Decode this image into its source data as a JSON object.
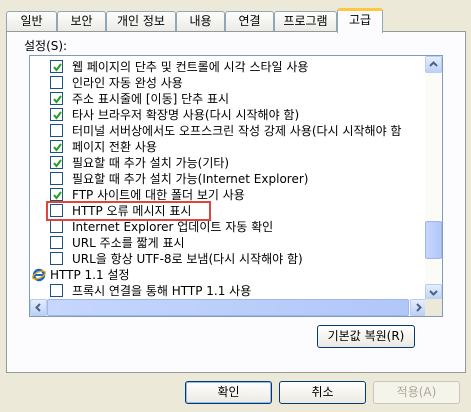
{
  "tabs": [
    {
      "label": "일반"
    },
    {
      "label": "보안"
    },
    {
      "label": "개인 정보"
    },
    {
      "label": "내용"
    },
    {
      "label": "연결"
    },
    {
      "label": "프로그램"
    },
    {
      "label": "고급",
      "active": true
    }
  ],
  "settings": {
    "label": "설정(S):",
    "items": [
      {
        "label": "웹 페이지의 단추 및 컨트롤에 시각 스타일 사용",
        "checked": true
      },
      {
        "label": "인라인 자동 완성 사용",
        "checked": false
      },
      {
        "label": "주소 표시줄에 [이동] 단추 표시",
        "checked": true
      },
      {
        "label": "타사 브라우저 확장명 사용(다시 시작해야 함)",
        "checked": true
      },
      {
        "label": "터미널 서버상에서도 오프스크린 작성 강제 사용(다시 시작해야 함",
        "checked": false
      },
      {
        "label": "페이지 전환 사용",
        "checked": true
      },
      {
        "label": "필요할 때 추가 설치 가능(기타)",
        "checked": true
      },
      {
        "label": "필요할 때 추가 설치 가능(Internet Explorer)",
        "checked": false
      },
      {
        "label": "FTP 사이트에 대한 폴더 보기 사용",
        "checked": true
      },
      {
        "label": "HTTP 오류 메시지 표시",
        "checked": false,
        "highlighted": true
      },
      {
        "label": "Internet Explorer 업데이트 자동 확인",
        "checked": false
      },
      {
        "label": "URL 주소를 짧게 표시",
        "checked": false
      },
      {
        "label": "URL을 항상 UTF-8로 보냄(다시 시작해야 함)",
        "checked": false
      }
    ],
    "group": {
      "label": "HTTP 1.1 설정",
      "icon": "ie-icon"
    },
    "group_items": [
      {
        "label": "프록시 연결을 통해 HTTP 1.1 사용",
        "checked": false
      }
    ]
  },
  "buttons": {
    "restore_defaults": "기본값 복원(R)",
    "ok": "확인",
    "cancel": "취소",
    "apply": "적용(A)"
  },
  "colors": {
    "highlight_border": "#e0443c",
    "checkmark": "#21a121",
    "active_tab_accent": "#ffc83c"
  }
}
